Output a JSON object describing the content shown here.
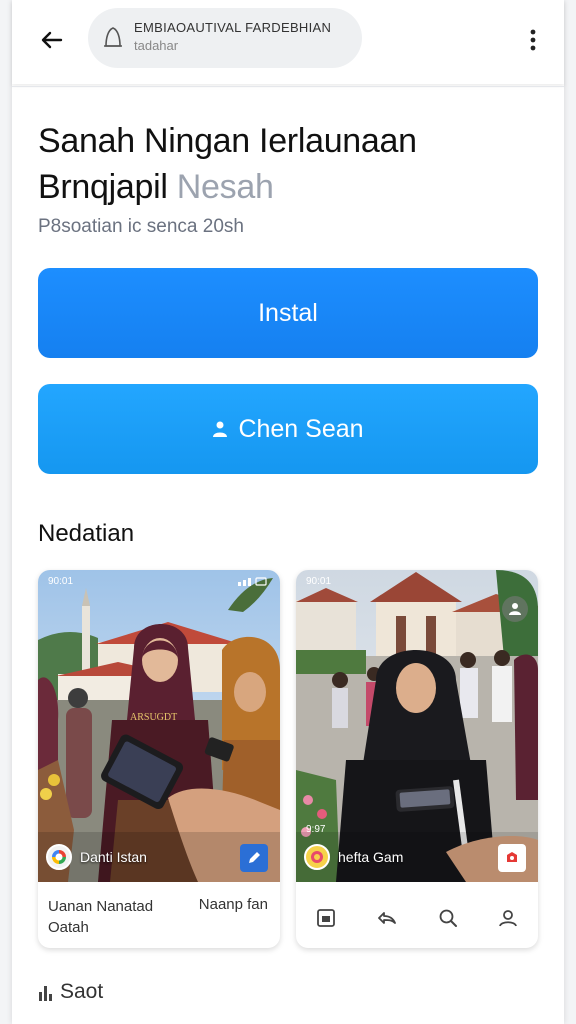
{
  "header": {
    "url_line1": "EMBIAOAUTIVAL FARDEBHIAN",
    "url_line2": "tadahar",
    "icons": [
      "back-arrow-icon",
      "lock-icon",
      "more-vertical-icon"
    ]
  },
  "app": {
    "title_main": "Sanah Ningan Ierlaunaan Brnqjapil",
    "title_light": "Nesah",
    "subtitle": "P8soatian ic senca 20sh"
  },
  "buttons": {
    "install_label": "Instal",
    "open_label": "Chen Sean"
  },
  "section": {
    "title": "Nedatian"
  },
  "cards": [
    {
      "status_left": "90:01",
      "channel_name": "Danti Istan",
      "caption_left_1": "Uanan Nanatad",
      "caption_left_2": "Oatah",
      "caption_right": "Naanp fan"
    },
    {
      "status_left": "90:01",
      "overlay_text": "9:97",
      "channel_name": "hefta Gam"
    }
  ],
  "footer": {
    "label": "Saot"
  },
  "colors": {
    "install": "#1a8cff",
    "open": "#1aa0f8",
    "title_light": "#9ca3af"
  }
}
